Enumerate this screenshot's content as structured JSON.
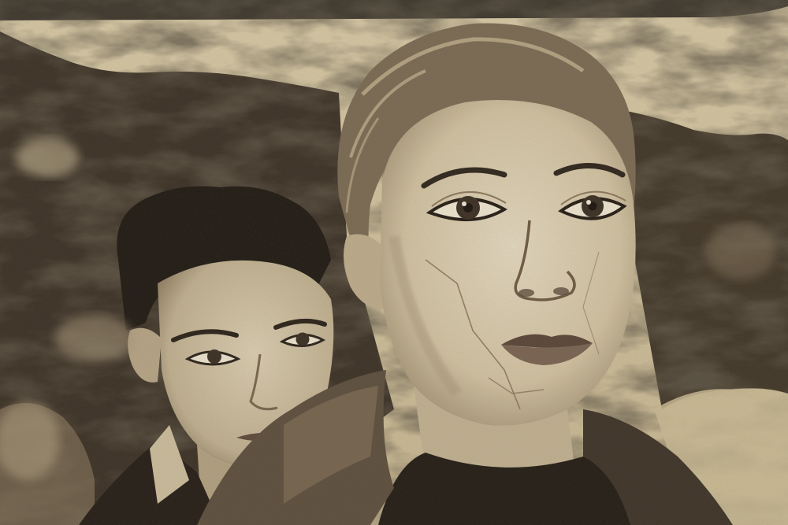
{
  "image": {
    "subject": "",
    "palette": {
      "wall_light": "#d8c9a6",
      "wall_mid": "#b6a582",
      "paint_dark": "#3a3026",
      "paint_deep": "#1f1a14",
      "skin_light": "#e2d6bc",
      "skin_shadow": "#b9a88a",
      "lips": "#6b5548",
      "hair_light": "#c9b795",
      "coat": "#4a3f33",
      "top_band": "#3d372e"
    }
  }
}
